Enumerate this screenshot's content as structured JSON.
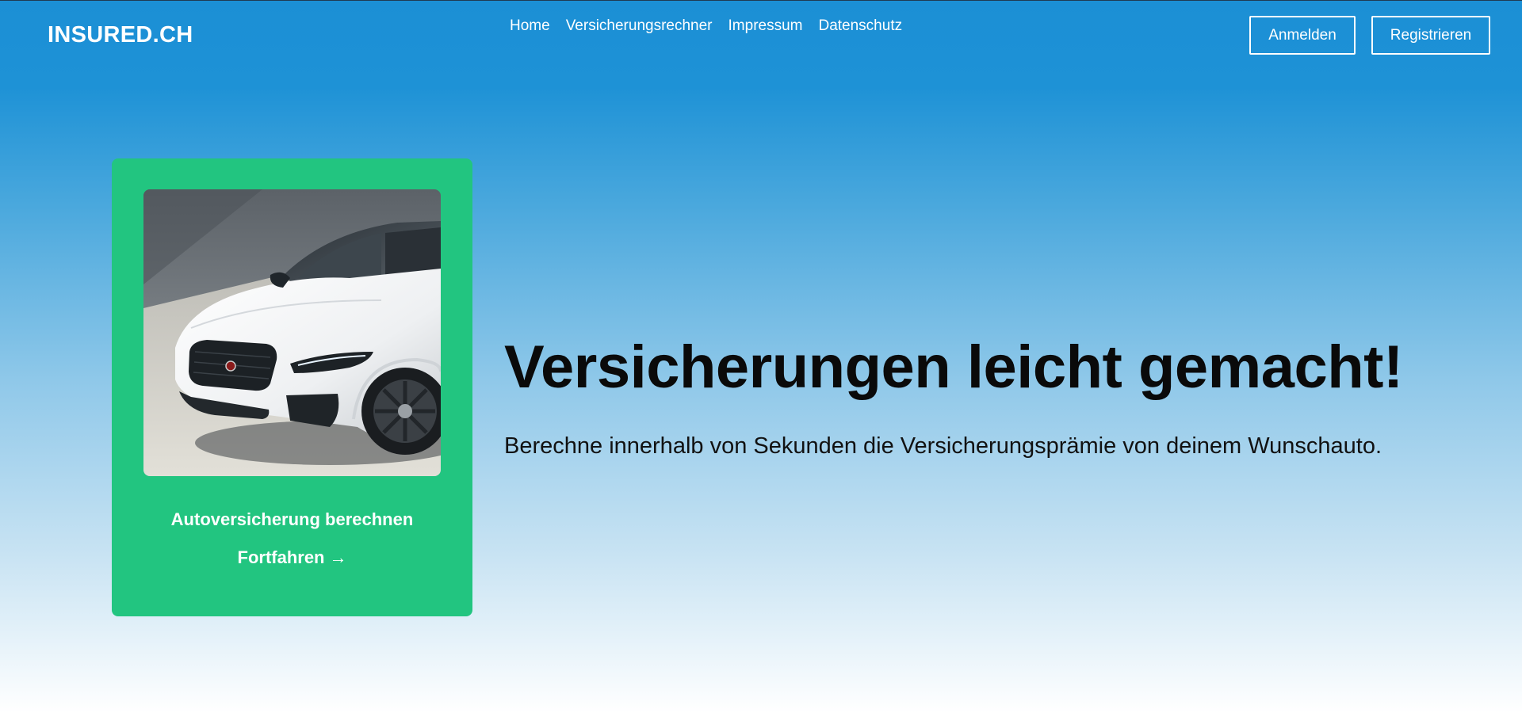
{
  "header": {
    "logo": "INSURED.CH",
    "nav": [
      {
        "label": "Home"
      },
      {
        "label": "Versicherungsrechner"
      },
      {
        "label": "Impressum"
      },
      {
        "label": "Datenschutz"
      }
    ],
    "login_label": "Anmelden",
    "register_label": "Registrieren"
  },
  "card": {
    "image_icon": "white-jaguar-car-photo",
    "title": "Autoversicherung berechnen",
    "link_label": "Fortfahren",
    "link_arrow": "→"
  },
  "hero": {
    "title": "Versicherungen leicht gemacht!",
    "subtitle": "Berechne innerhalb von Sekunden die Versicherungsprämie von deinem Wunschauto."
  },
  "colors": {
    "header_blue": "#1b8fd5",
    "card_green": "#22c580",
    "text_dark": "#0a0a0a"
  }
}
